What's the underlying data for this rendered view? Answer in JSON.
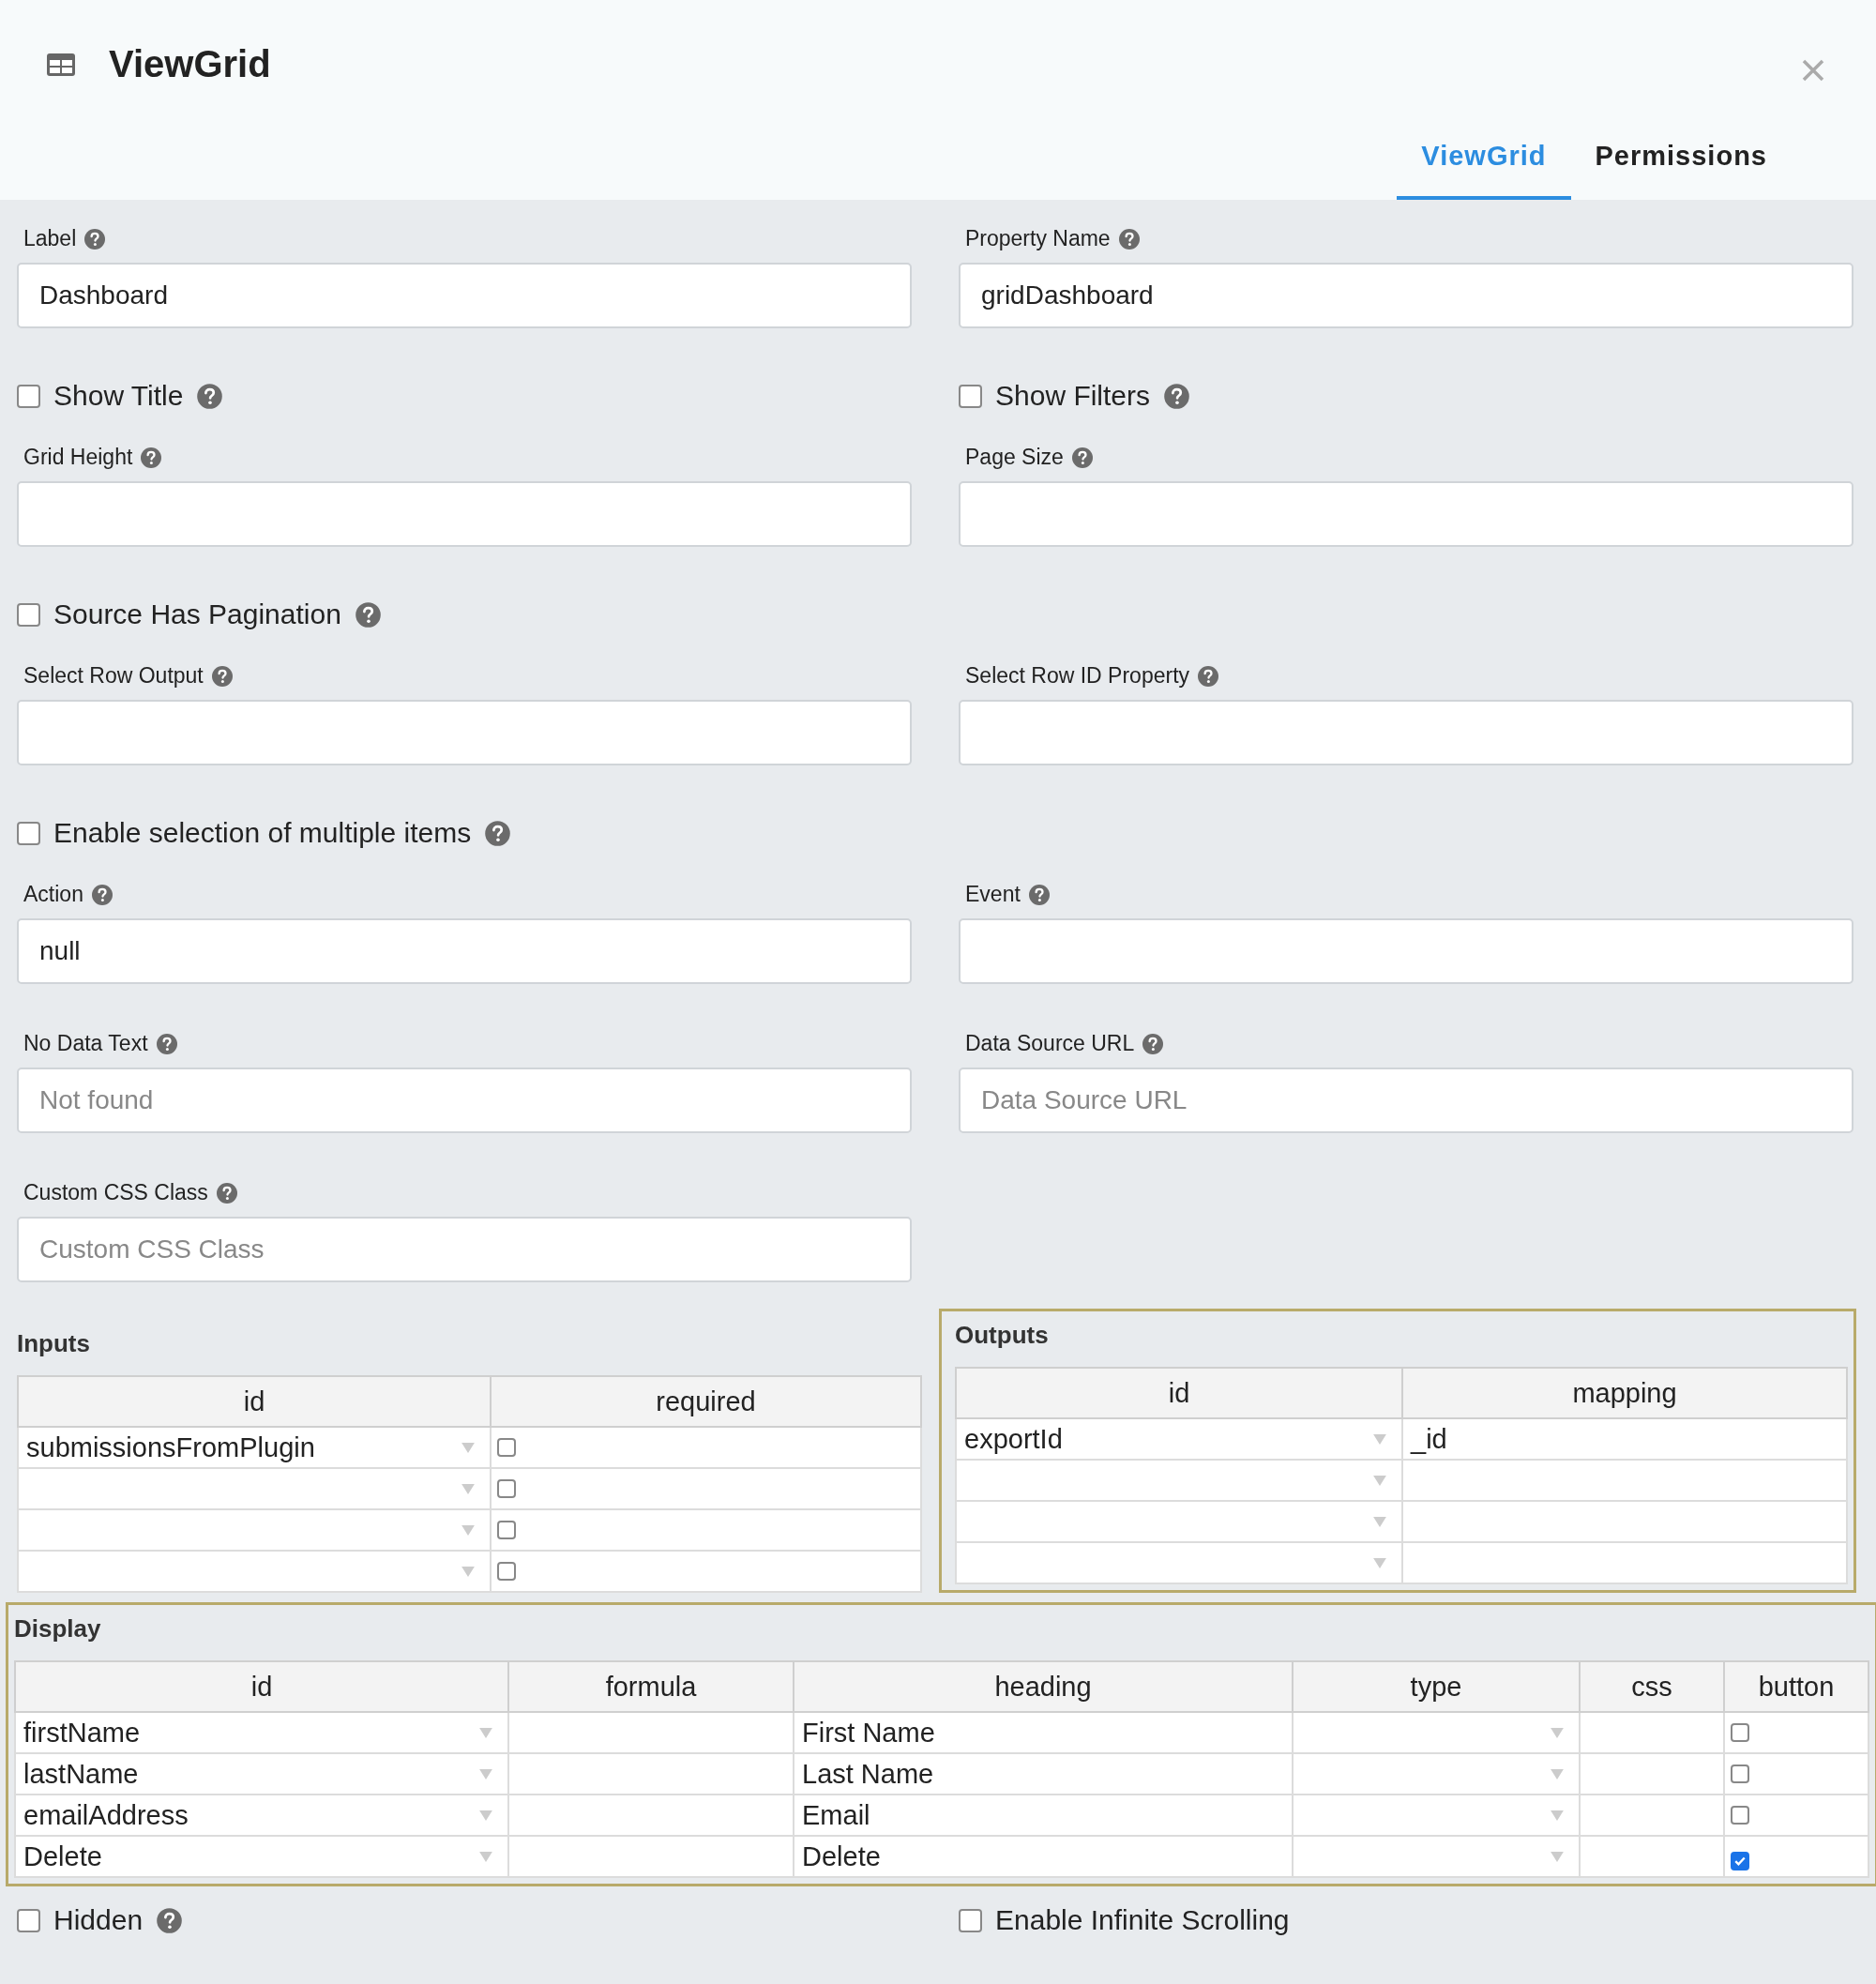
{
  "dialog": {
    "title": "ViewGrid",
    "tabs": [
      {
        "label": "ViewGrid",
        "selected": true
      },
      {
        "label": "Permissions",
        "selected": false
      }
    ]
  },
  "rows": [
    [
      {
        "kind": "field",
        "label": "Label",
        "help": true,
        "value": "Dashboard"
      },
      {
        "kind": "field",
        "label": "Property Name",
        "help": true,
        "value": "gridDashboard"
      }
    ],
    [
      {
        "kind": "checkbox",
        "label": "Show Title",
        "help": true,
        "checked": false
      },
      {
        "kind": "checkbox",
        "label": "Show Filters",
        "help": true,
        "checked": false
      }
    ],
    [
      {
        "kind": "field",
        "label": "Grid Height",
        "help": true
      },
      {
        "kind": "field",
        "label": "Page Size",
        "help": true
      }
    ],
    [
      {
        "kind": "checkbox",
        "label": "Source Has Pagination",
        "help": true,
        "checked": false
      }
    ],
    [
      {
        "kind": "field",
        "label": "Select Row Output",
        "help": true
      },
      {
        "kind": "field",
        "label": "Select Row ID Property",
        "help": true
      }
    ],
    [
      {
        "kind": "checkbox",
        "label": "Enable selection of multiple items",
        "help": true,
        "checked": false
      }
    ],
    [
      {
        "kind": "field",
        "label": "Action",
        "help": true,
        "value": "null"
      },
      {
        "kind": "field",
        "label": "Event",
        "help": true
      }
    ],
    [
      {
        "kind": "field",
        "label": "No Data Text",
        "help": true,
        "placeholder": "Not found"
      },
      {
        "kind": "field",
        "label": "Data Source URL",
        "help": true,
        "placeholder": "Data Source URL"
      }
    ],
    [
      {
        "kind": "field",
        "label": "Custom CSS Class",
        "help": true,
        "placeholder": "Custom CSS Class"
      }
    ]
  ],
  "inputs": {
    "title": "Inputs",
    "highlighted": false,
    "columns": [
      {
        "label": "id",
        "kind": "select"
      },
      {
        "label": "required",
        "kind": "checkbox"
      }
    ],
    "rows": [
      [
        "submissionsFromPlugin",
        false
      ],
      [
        "",
        false
      ],
      [
        "",
        false
      ],
      [
        "",
        false
      ]
    ]
  },
  "outputs": {
    "title": "Outputs",
    "highlighted": true,
    "columns": [
      {
        "label": "id",
        "kind": "select"
      },
      {
        "label": "mapping",
        "kind": "text"
      }
    ],
    "rows": [
      [
        "exportId",
        "_id"
      ],
      [
        "",
        ""
      ],
      [
        "",
        ""
      ],
      [
        "",
        ""
      ]
    ]
  },
  "display": {
    "title": "Display",
    "highlighted": true,
    "columns": [
      {
        "label": "id",
        "kind": "select"
      },
      {
        "label": "formula",
        "kind": "text"
      },
      {
        "label": "heading",
        "kind": "text"
      },
      {
        "label": "type",
        "kind": "select"
      },
      {
        "label": "css",
        "kind": "text"
      },
      {
        "label": "button",
        "kind": "checkbox"
      }
    ],
    "rows": [
      [
        "firstName",
        "",
        "First Name",
        "",
        "",
        false
      ],
      [
        "lastName",
        "",
        "Last Name",
        "",
        "",
        false
      ],
      [
        "emailAddress",
        "",
        "Email",
        "",
        "",
        false
      ],
      [
        "Delete",
        "",
        "Delete",
        "",
        "",
        true
      ]
    ]
  },
  "footer": [
    {
      "kind": "checkbox",
      "label": "Hidden",
      "help": true,
      "checked": false
    },
    {
      "kind": "checkbox",
      "label": "Enable Infinite Scrolling",
      "help": false,
      "checked": false
    }
  ]
}
